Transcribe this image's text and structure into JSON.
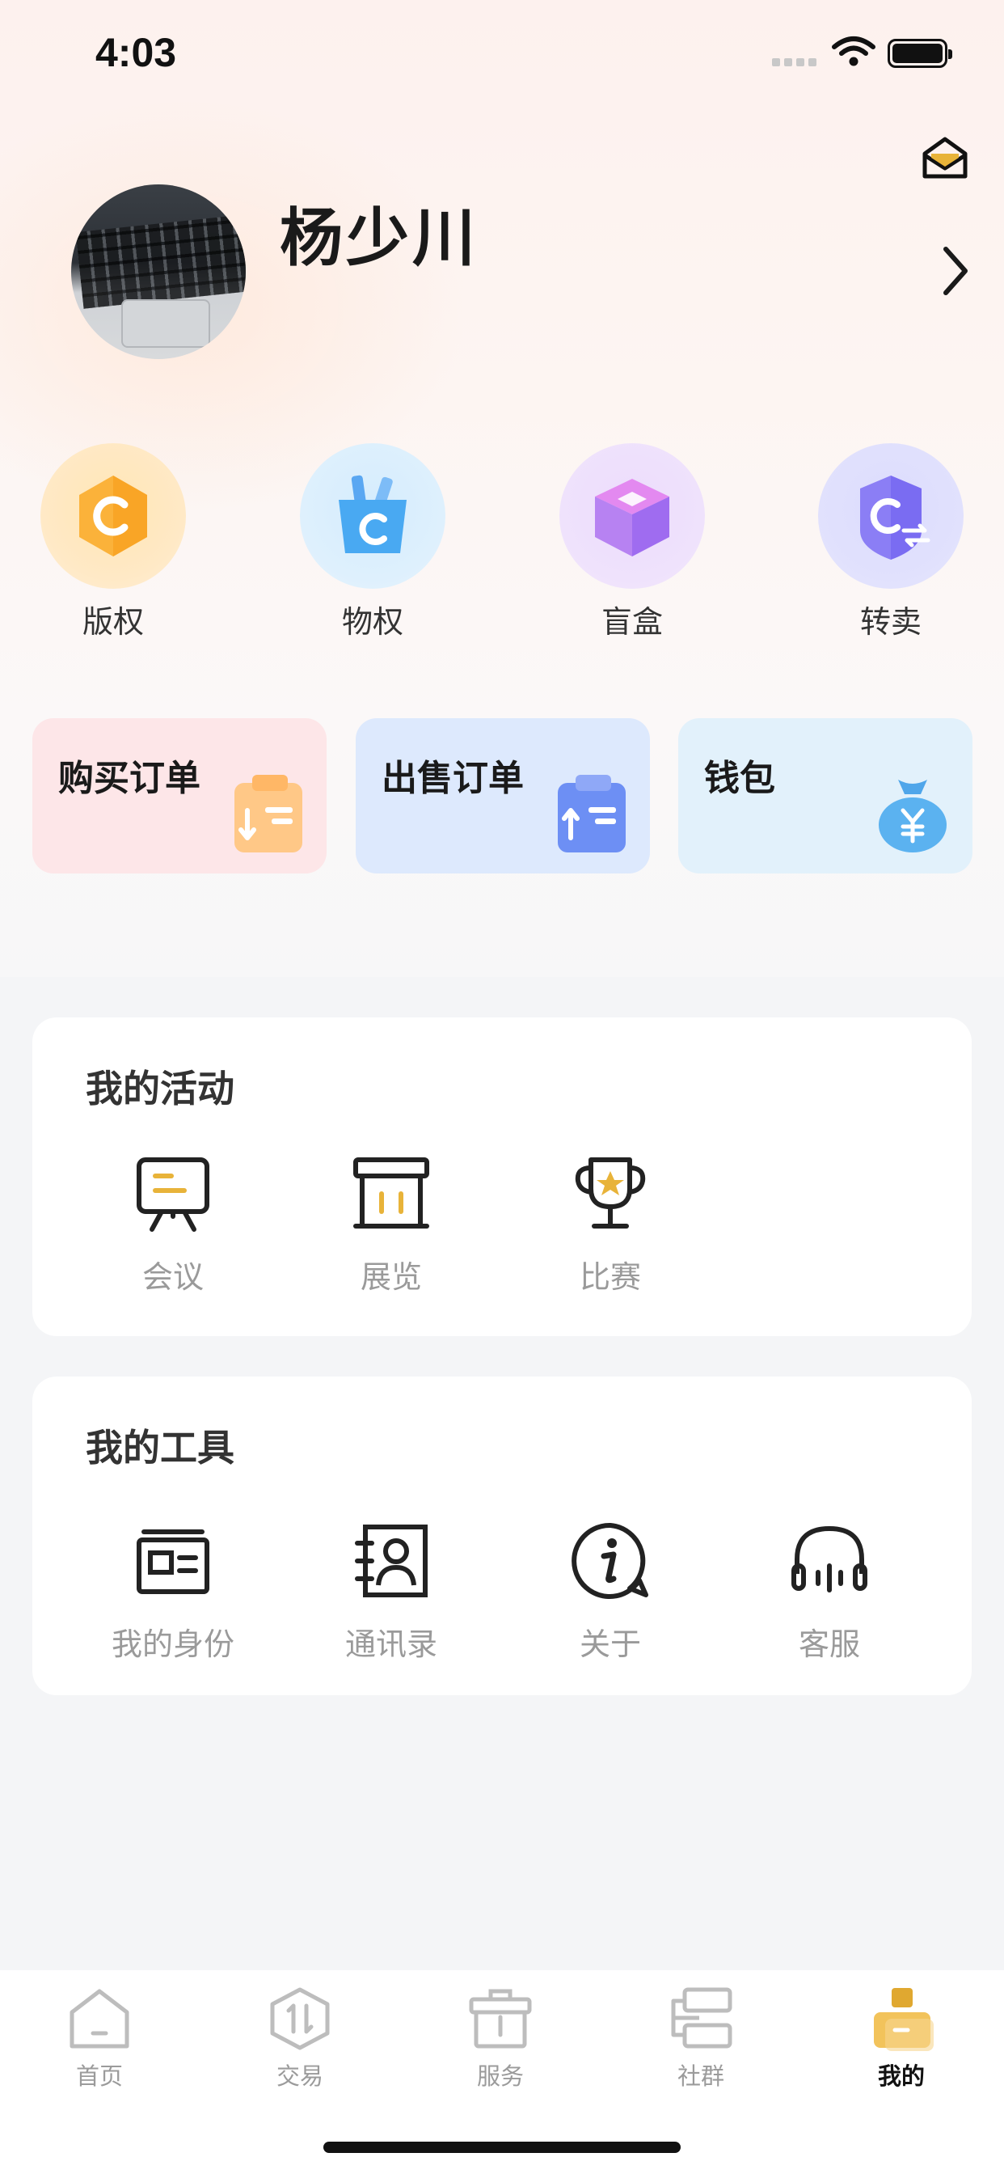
{
  "status_bar": {
    "time": "4:03"
  },
  "profile": {
    "name": "杨少川"
  },
  "quick_actions": [
    {
      "label": "版权",
      "icon": "copyright-shield-icon"
    },
    {
      "label": "物权",
      "icon": "property-bag-icon"
    },
    {
      "label": "盲盒",
      "icon": "blind-box-icon"
    },
    {
      "label": "转卖",
      "icon": "resell-shield-icon"
    }
  ],
  "order_cards": [
    {
      "title": "购买订单",
      "icon": "purchase-order-icon"
    },
    {
      "title": "出售订单",
      "icon": "sell-order-icon"
    },
    {
      "title": "钱包",
      "icon": "wallet-moneybag-icon"
    }
  ],
  "activities": {
    "title": "我的活动",
    "items": [
      {
        "label": "会议",
        "icon": "meeting-board-icon"
      },
      {
        "label": "展览",
        "icon": "exhibition-icon"
      },
      {
        "label": "比赛",
        "icon": "trophy-icon"
      }
    ]
  },
  "tools": {
    "title": "我的工具",
    "items": [
      {
        "label": "我的身份",
        "icon": "id-card-icon"
      },
      {
        "label": "通讯录",
        "icon": "contacts-book-icon"
      },
      {
        "label": "关于",
        "icon": "info-icon"
      },
      {
        "label": "客服",
        "icon": "headset-icon"
      }
    ]
  },
  "tabbar": {
    "items": [
      {
        "label": "首页",
        "icon": "home-icon"
      },
      {
        "label": "交易",
        "icon": "trade-icon"
      },
      {
        "label": "服务",
        "icon": "service-box-icon"
      },
      {
        "label": "社群",
        "icon": "community-icon"
      },
      {
        "label": "我的",
        "icon": "mine-icon",
        "active": true
      }
    ]
  },
  "colors": {
    "accent": "#e8b339",
    "active_tab": "#111111",
    "inactive_tab": "#9b9b9b"
  }
}
